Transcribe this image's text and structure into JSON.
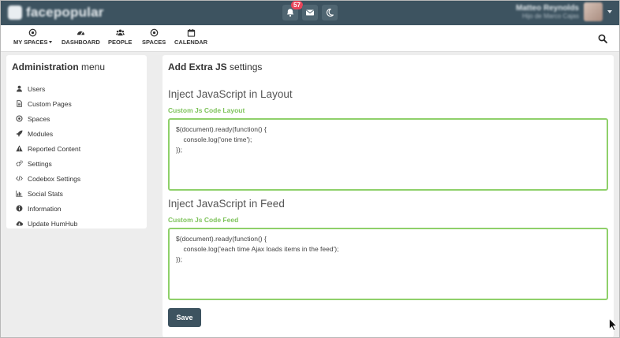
{
  "app": {
    "logo_text": "facepopular"
  },
  "topbar": {
    "notification_count": "57",
    "user_name": "Matteo Reynolds",
    "user_subtitle": "Hijo de Marco Cajas",
    "icons": [
      "bell-icon",
      "envelope-icon",
      "moon-icon"
    ]
  },
  "nav": {
    "items": [
      {
        "label": "MY SPACES",
        "icon": "dot-circle-icon"
      },
      {
        "label": "DASHBOARD",
        "icon": "tachometer-icon"
      },
      {
        "label": "PEOPLE",
        "icon": "users-icon"
      },
      {
        "label": "SPACES",
        "icon": "dot-circle-icon"
      },
      {
        "label": "CALENDAR",
        "icon": "calendar-icon"
      }
    ],
    "search_icon": "search-icon"
  },
  "sidebar": {
    "title_bold": "Administration",
    "title_rest": "menu",
    "items": [
      {
        "label": "Users",
        "icon": "user-icon"
      },
      {
        "label": "Custom Pages",
        "icon": "file-icon"
      },
      {
        "label": "Spaces",
        "icon": "dot-circle-icon"
      },
      {
        "label": "Modules",
        "icon": "rocket-icon"
      },
      {
        "label": "Reported Content",
        "icon": "warning-icon"
      },
      {
        "label": "Settings",
        "icon": "cogs-icon"
      },
      {
        "label": "Codebox Settings",
        "icon": "code-icon"
      },
      {
        "label": "Social Stats",
        "icon": "bar-chart-icon"
      },
      {
        "label": "Information",
        "icon": "info-icon"
      },
      {
        "label": "Update HumHub",
        "icon": "cloud-download-icon"
      }
    ]
  },
  "main": {
    "title_bold": "Add Extra JS",
    "title_rest": "settings",
    "layout_section": {
      "heading": "Inject JavaScript in Layout",
      "label": "Custom Js Code Layout",
      "code": "$(document).ready(function() {\n    console.log('one time');\n});"
    },
    "feed_section": {
      "heading": "Inject JavaScript in Feed",
      "label": "Custom Js Code Feed",
      "code": "$(document).ready(function() {\n    console.log('each time Ajax loads items in the feed');\n});"
    },
    "save_label": "Save"
  },
  "colors": {
    "topbar": "#3d5360",
    "accent_green": "#7ec35b",
    "badge": "#e8455a",
    "background": "#ededed"
  }
}
